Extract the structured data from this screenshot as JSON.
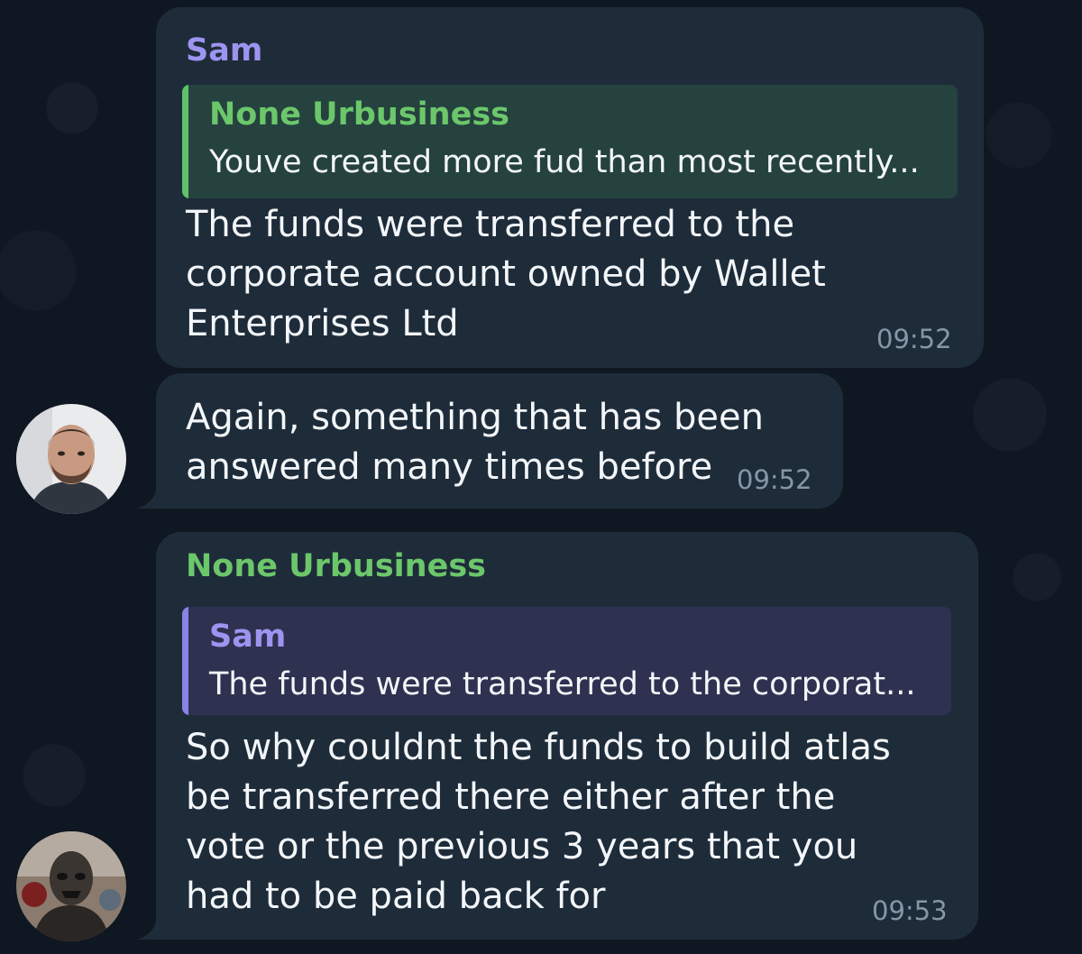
{
  "messages": [
    {
      "sender": "Sam",
      "reply": {
        "name": "None Urbusiness",
        "text": "Youve created more fud than most recently..."
      },
      "text": "The funds were transferred to the\ncorporate account owned by Wallet\nEnterprises Ltd",
      "time": "09:52"
    },
    {
      "text": "Again, something that has been\nanswered many times before",
      "time": "09:52"
    },
    {
      "sender": "None Urbusiness",
      "reply": {
        "name": "Sam",
        "text": "The funds were transferred to the corporat..."
      },
      "text": "So why couldnt the funds to build atlas\nbe transferred there either after the\nvote or the previous 3 years that you\nhad to be paid back for",
      "time": "09:53"
    }
  ],
  "avatars": {
    "sam": "avatar-sam",
    "none_urbusiness": "avatar-none-urbusiness"
  },
  "colors": {
    "background": "#0e1621",
    "bubble": "#1e2c3a",
    "sam_name": "#9d94f0",
    "none_urbusiness_name": "#6cc76b",
    "timestamp": "#8597a7"
  }
}
